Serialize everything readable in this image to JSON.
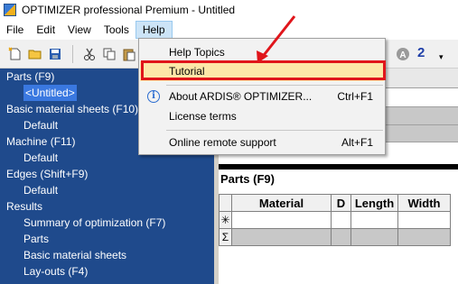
{
  "window": {
    "title": "OPTIMIZER professional Premium - Untitled"
  },
  "menubar": {
    "items": [
      {
        "label": "File"
      },
      {
        "label": "Edit"
      },
      {
        "label": "View"
      },
      {
        "label": "Tools"
      },
      {
        "label": "Help"
      }
    ]
  },
  "toolbar": {
    "number_label": "2"
  },
  "help_menu": {
    "items": [
      {
        "label": "Help Topics",
        "shortcut": ""
      },
      {
        "label": "Tutorial",
        "shortcut": ""
      },
      {
        "label": "About ARDIS® OPTIMIZER...",
        "shortcut": "Ctrl+F1"
      },
      {
        "label": "License terms",
        "shortcut": ""
      },
      {
        "label": "Online remote support",
        "shortcut": "Alt+F1"
      }
    ]
  },
  "tree": {
    "items": [
      {
        "label": "Parts (F9)"
      },
      {
        "label": "<Untitled>"
      },
      {
        "label": "Basic material sheets (F10)"
      },
      {
        "label": "Default"
      },
      {
        "label": "Machine (F11)"
      },
      {
        "label": "Default"
      },
      {
        "label": "Edges (Shift+F9)"
      },
      {
        "label": "Default"
      },
      {
        "label": "Results"
      },
      {
        "label": "Summary of optimization (F7)"
      },
      {
        "label": "Parts"
      },
      {
        "label": "Basic material sheets"
      },
      {
        "label": "Lay-outs (F4)"
      }
    ]
  },
  "parts_panel": {
    "title": "Parts (F9)",
    "columns": [
      "Material",
      "D",
      "Length",
      "Width"
    ],
    "row_headers": [
      "✳",
      "Σ"
    ]
  },
  "colors": {
    "tree_bg": "#1f4a8c",
    "tree_selected": "#3a78e0",
    "highlight_red": "#e0151b",
    "menu_highlight": "#fde7a8"
  }
}
